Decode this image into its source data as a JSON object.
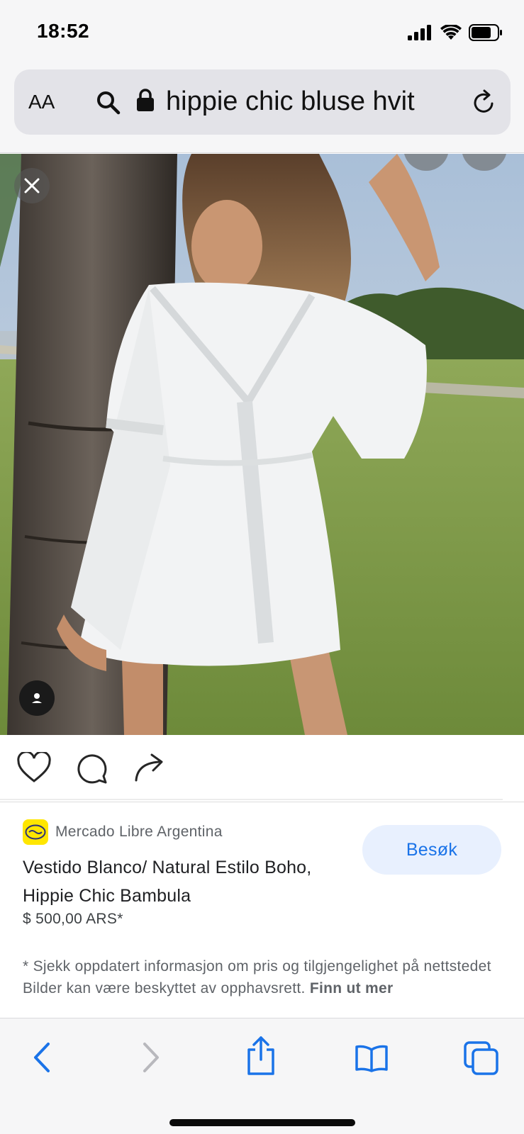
{
  "status_bar": {
    "time": "18:52"
  },
  "address_bar": {
    "text_size_label": "AA",
    "url_text": "hippie chic bluse hvit"
  },
  "result": {
    "source_name": "Mercado Libre Argentina",
    "title": "Vestido Blanco/ Natural Estilo Boho, Hippie Chic Bambula",
    "price": "$ 500,00 ARS*",
    "visit_label": "Besøk",
    "disclaimer": "* Sjekk oppdatert informasjon om pris og tilgjengelighet på nettstedet Bilder kan være beskyttet av opphavsrett.",
    "more_link": "Finn ut mer"
  },
  "colors": {
    "accent": "#1a73e8",
    "visit_bg": "#e8f0fe",
    "mercado_yellow": "#ffe600",
    "chrome_bg": "#f6f6f7"
  },
  "icons": {
    "status": [
      "cellular-signal-icon",
      "wifi-icon",
      "battery-icon"
    ],
    "address": [
      "search-icon",
      "lock-icon",
      "reload-icon"
    ],
    "photo": [
      "close-icon",
      "person-icon"
    ],
    "actions": [
      "heart-icon",
      "comment-icon",
      "share-arrow-icon"
    ],
    "toolbar": [
      "back-icon",
      "forward-icon",
      "share-icon",
      "bookmarks-icon",
      "tabs-icon"
    ]
  }
}
